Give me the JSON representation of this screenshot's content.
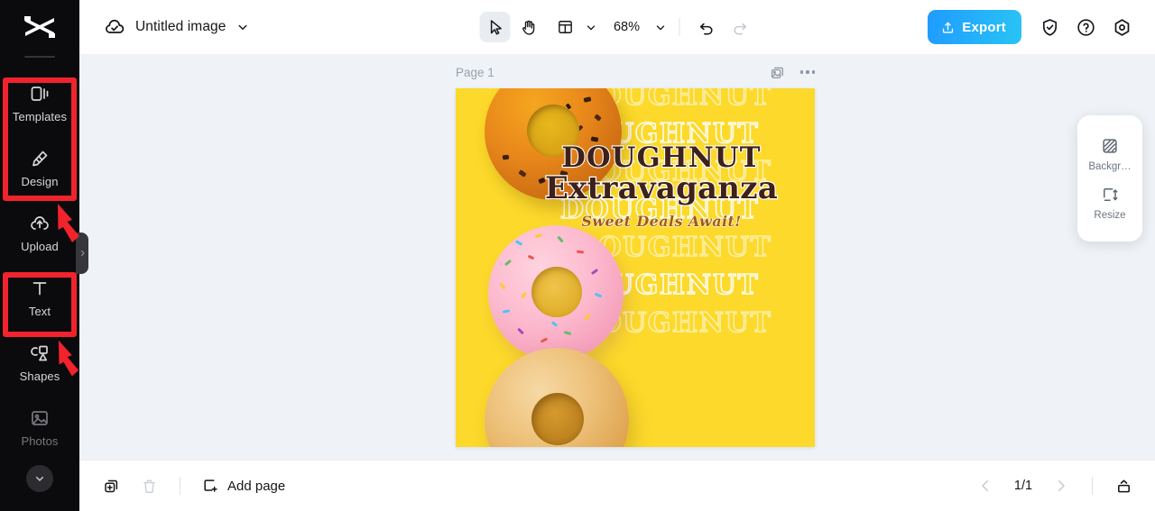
{
  "app": {
    "logo_icon": "capcut-logo-icon"
  },
  "sidebar": {
    "items": [
      {
        "label": "Templates",
        "icon": "templates-icon",
        "dim": false
      },
      {
        "label": "Design",
        "icon": "design-icon",
        "dim": false
      },
      {
        "label": "Upload",
        "icon": "upload-cloud-icon",
        "dim": false
      },
      {
        "label": "Text",
        "icon": "text-icon",
        "dim": false
      },
      {
        "label": "Shapes",
        "icon": "shapes-icon",
        "dim": false
      },
      {
        "label": "Photos",
        "icon": "photos-icon",
        "dim": true
      }
    ],
    "more_icon": "chevron-down-icon",
    "collapse_icon": "chevron-right-icon"
  },
  "topbar": {
    "cloud_icon": "cloud-saved-icon",
    "title": "Untitled image",
    "title_caret_icon": "chevron-down-icon",
    "tools": [
      {
        "name": "cursor-tool",
        "icon": "cursor-arrow-icon",
        "active": true
      },
      {
        "name": "hand-tool",
        "icon": "hand-icon",
        "active": false
      },
      {
        "name": "layout-tool",
        "icon": "layout-grid-icon",
        "active": false
      }
    ],
    "layout_caret_icon": "chevron-down-icon",
    "zoom_level": "68%",
    "zoom_caret_icon": "chevron-down-icon",
    "undo_icon": "undo-icon",
    "redo_icon": "redo-icon",
    "export_label": "Export",
    "export_icon": "upload-share-icon",
    "export_color": "#1f9bff",
    "shield_icon": "shield-check-icon",
    "help_icon": "question-circle-icon",
    "settings_icon": "settings-hex-icon"
  },
  "canvas_header": {
    "page_label": "Page 1",
    "duplicate_icon": "duplicate-image-icon",
    "more_icon": "more-horizontal-icon"
  },
  "poster": {
    "background_color": "#fcd92b",
    "headline_1": "DOUGHNUT",
    "headline_2": "Extravaganza",
    "tagline": "Sweet Deals Await!",
    "headline_color": "#3e211a",
    "tagline_color": "#a05a16",
    "ghost_text": "DOUGHNUT",
    "ghost_repeat_count": 7
  },
  "right_panel": {
    "items": [
      {
        "label": "Backgr…",
        "icon": "background-hatch-icon"
      },
      {
        "label": "Resize",
        "icon": "resize-icon"
      }
    ]
  },
  "bottombar": {
    "duplicate_icon": "duplicate-page-icon",
    "delete_icon": "trash-icon",
    "add_page_label": "Add page",
    "add_page_icon": "square-plus-icon",
    "prev_icon": "chevron-left-icon",
    "page_count": "1/1",
    "next_icon": "chevron-right-icon",
    "expand_icon": "expand-panel-icon"
  },
  "annotations": {
    "highlight_color": "#f1232d",
    "boxes": [
      {
        "name": "templates-design-highlight"
      },
      {
        "name": "text-highlight"
      }
    ],
    "arrows": [
      {
        "name": "arrow-to-templates-design"
      },
      {
        "name": "arrow-to-text"
      }
    ]
  }
}
